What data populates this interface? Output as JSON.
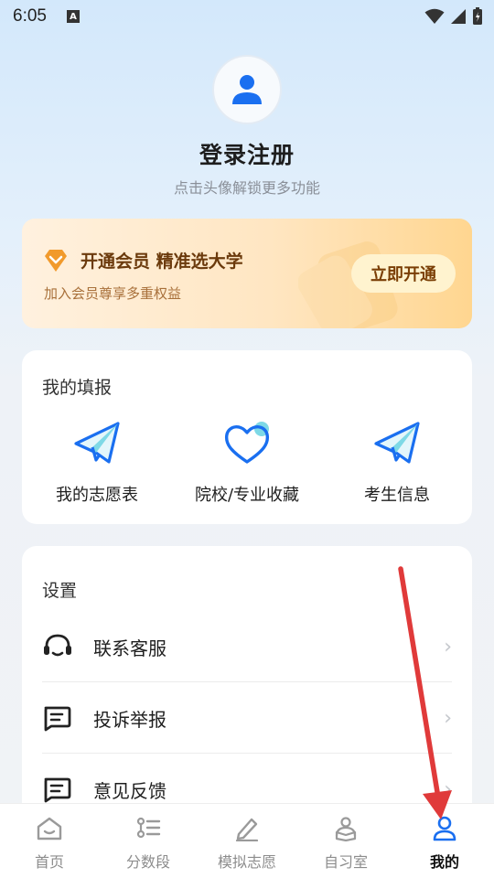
{
  "status_bar": {
    "time": "6:05",
    "notification_badge": "A"
  },
  "profile": {
    "title": "登录注册",
    "subtitle": "点击头像解锁更多功能"
  },
  "vip": {
    "title": "开通会员 精准选大学",
    "subtitle": "加入会员尊享多重权益",
    "button": "立即开通",
    "accent_color": "#f0a030"
  },
  "my_fill": {
    "title": "我的填报",
    "items": [
      {
        "label": "我的志愿表",
        "icon": "paper-plane-icon"
      },
      {
        "label": "院校/专业收藏",
        "icon": "heart-icon"
      },
      {
        "label": "考生信息",
        "icon": "paper-plane-icon"
      }
    ]
  },
  "settings": {
    "title": "设置",
    "items": [
      {
        "label": "联系客服",
        "icon": "headset-icon"
      },
      {
        "label": "投诉举报",
        "icon": "message-icon"
      },
      {
        "label": "意见反馈",
        "icon": "message-icon"
      }
    ]
  },
  "tabs": [
    {
      "label": "首页",
      "icon": "home-icon"
    },
    {
      "label": "分数段",
      "icon": "list-icon"
    },
    {
      "label": "模拟志愿",
      "icon": "pencil-icon"
    },
    {
      "label": "自习室",
      "icon": "study-icon"
    },
    {
      "label": "我的",
      "icon": "user-icon",
      "active": true
    }
  ],
  "colors": {
    "primary": "#1a6ff0",
    "annotation_arrow": "#e03a3a"
  }
}
